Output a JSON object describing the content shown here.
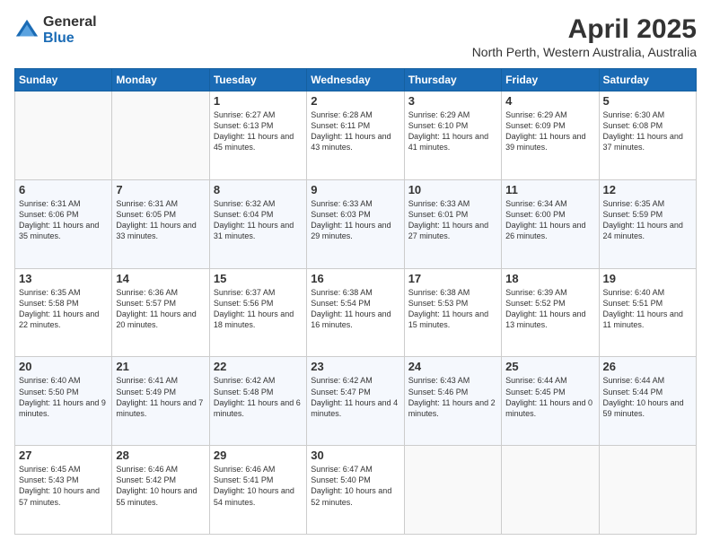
{
  "logo": {
    "general": "General",
    "blue": "Blue"
  },
  "header": {
    "month": "April 2025",
    "subtitle": "North Perth, Western Australia, Australia"
  },
  "weekdays": [
    "Sunday",
    "Monday",
    "Tuesday",
    "Wednesday",
    "Thursday",
    "Friday",
    "Saturday"
  ],
  "weeks": [
    [
      {
        "day": "",
        "sunrise": "",
        "sunset": "",
        "daylight": ""
      },
      {
        "day": "",
        "sunrise": "",
        "sunset": "",
        "daylight": ""
      },
      {
        "day": "1",
        "sunrise": "Sunrise: 6:27 AM",
        "sunset": "Sunset: 6:13 PM",
        "daylight": "Daylight: 11 hours and 45 minutes."
      },
      {
        "day": "2",
        "sunrise": "Sunrise: 6:28 AM",
        "sunset": "Sunset: 6:11 PM",
        "daylight": "Daylight: 11 hours and 43 minutes."
      },
      {
        "day": "3",
        "sunrise": "Sunrise: 6:29 AM",
        "sunset": "Sunset: 6:10 PM",
        "daylight": "Daylight: 11 hours and 41 minutes."
      },
      {
        "day": "4",
        "sunrise": "Sunrise: 6:29 AM",
        "sunset": "Sunset: 6:09 PM",
        "daylight": "Daylight: 11 hours and 39 minutes."
      },
      {
        "day": "5",
        "sunrise": "Sunrise: 6:30 AM",
        "sunset": "Sunset: 6:08 PM",
        "daylight": "Daylight: 11 hours and 37 minutes."
      }
    ],
    [
      {
        "day": "6",
        "sunrise": "Sunrise: 6:31 AM",
        "sunset": "Sunset: 6:06 PM",
        "daylight": "Daylight: 11 hours and 35 minutes."
      },
      {
        "day": "7",
        "sunrise": "Sunrise: 6:31 AM",
        "sunset": "Sunset: 6:05 PM",
        "daylight": "Daylight: 11 hours and 33 minutes."
      },
      {
        "day": "8",
        "sunrise": "Sunrise: 6:32 AM",
        "sunset": "Sunset: 6:04 PM",
        "daylight": "Daylight: 11 hours and 31 minutes."
      },
      {
        "day": "9",
        "sunrise": "Sunrise: 6:33 AM",
        "sunset": "Sunset: 6:03 PM",
        "daylight": "Daylight: 11 hours and 29 minutes."
      },
      {
        "day": "10",
        "sunrise": "Sunrise: 6:33 AM",
        "sunset": "Sunset: 6:01 PM",
        "daylight": "Daylight: 11 hours and 27 minutes."
      },
      {
        "day": "11",
        "sunrise": "Sunrise: 6:34 AM",
        "sunset": "Sunset: 6:00 PM",
        "daylight": "Daylight: 11 hours and 26 minutes."
      },
      {
        "day": "12",
        "sunrise": "Sunrise: 6:35 AM",
        "sunset": "Sunset: 5:59 PM",
        "daylight": "Daylight: 11 hours and 24 minutes."
      }
    ],
    [
      {
        "day": "13",
        "sunrise": "Sunrise: 6:35 AM",
        "sunset": "Sunset: 5:58 PM",
        "daylight": "Daylight: 11 hours and 22 minutes."
      },
      {
        "day": "14",
        "sunrise": "Sunrise: 6:36 AM",
        "sunset": "Sunset: 5:57 PM",
        "daylight": "Daylight: 11 hours and 20 minutes."
      },
      {
        "day": "15",
        "sunrise": "Sunrise: 6:37 AM",
        "sunset": "Sunset: 5:56 PM",
        "daylight": "Daylight: 11 hours and 18 minutes."
      },
      {
        "day": "16",
        "sunrise": "Sunrise: 6:38 AM",
        "sunset": "Sunset: 5:54 PM",
        "daylight": "Daylight: 11 hours and 16 minutes."
      },
      {
        "day": "17",
        "sunrise": "Sunrise: 6:38 AM",
        "sunset": "Sunset: 5:53 PM",
        "daylight": "Daylight: 11 hours and 15 minutes."
      },
      {
        "day": "18",
        "sunrise": "Sunrise: 6:39 AM",
        "sunset": "Sunset: 5:52 PM",
        "daylight": "Daylight: 11 hours and 13 minutes."
      },
      {
        "day": "19",
        "sunrise": "Sunrise: 6:40 AM",
        "sunset": "Sunset: 5:51 PM",
        "daylight": "Daylight: 11 hours and 11 minutes."
      }
    ],
    [
      {
        "day": "20",
        "sunrise": "Sunrise: 6:40 AM",
        "sunset": "Sunset: 5:50 PM",
        "daylight": "Daylight: 11 hours and 9 minutes."
      },
      {
        "day": "21",
        "sunrise": "Sunrise: 6:41 AM",
        "sunset": "Sunset: 5:49 PM",
        "daylight": "Daylight: 11 hours and 7 minutes."
      },
      {
        "day": "22",
        "sunrise": "Sunrise: 6:42 AM",
        "sunset": "Sunset: 5:48 PM",
        "daylight": "Daylight: 11 hours and 6 minutes."
      },
      {
        "day": "23",
        "sunrise": "Sunrise: 6:42 AM",
        "sunset": "Sunset: 5:47 PM",
        "daylight": "Daylight: 11 hours and 4 minutes."
      },
      {
        "day": "24",
        "sunrise": "Sunrise: 6:43 AM",
        "sunset": "Sunset: 5:46 PM",
        "daylight": "Daylight: 11 hours and 2 minutes."
      },
      {
        "day": "25",
        "sunrise": "Sunrise: 6:44 AM",
        "sunset": "Sunset: 5:45 PM",
        "daylight": "Daylight: 11 hours and 0 minutes."
      },
      {
        "day": "26",
        "sunrise": "Sunrise: 6:44 AM",
        "sunset": "Sunset: 5:44 PM",
        "daylight": "Daylight: 10 hours and 59 minutes."
      }
    ],
    [
      {
        "day": "27",
        "sunrise": "Sunrise: 6:45 AM",
        "sunset": "Sunset: 5:43 PM",
        "daylight": "Daylight: 10 hours and 57 minutes."
      },
      {
        "day": "28",
        "sunrise": "Sunrise: 6:46 AM",
        "sunset": "Sunset: 5:42 PM",
        "daylight": "Daylight: 10 hours and 55 minutes."
      },
      {
        "day": "29",
        "sunrise": "Sunrise: 6:46 AM",
        "sunset": "Sunset: 5:41 PM",
        "daylight": "Daylight: 10 hours and 54 minutes."
      },
      {
        "day": "30",
        "sunrise": "Sunrise: 6:47 AM",
        "sunset": "Sunset: 5:40 PM",
        "daylight": "Daylight: 10 hours and 52 minutes."
      },
      {
        "day": "",
        "sunrise": "",
        "sunset": "",
        "daylight": ""
      },
      {
        "day": "",
        "sunrise": "",
        "sunset": "",
        "daylight": ""
      },
      {
        "day": "",
        "sunrise": "",
        "sunset": "",
        "daylight": ""
      }
    ]
  ]
}
